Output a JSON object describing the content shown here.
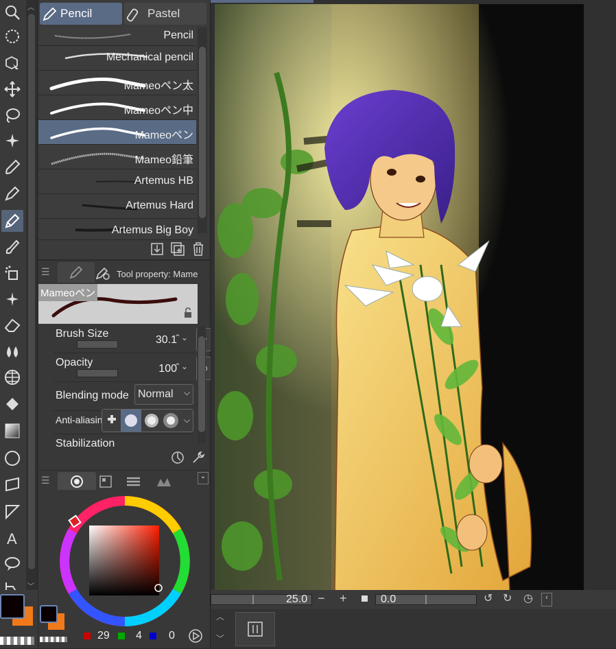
{
  "brush_tabs": {
    "pencil": "Pencil",
    "pastel": "Pastel"
  },
  "brushes": [
    {
      "name": "Pencil",
      "selected": false
    },
    {
      "name": "Mechanical pencil",
      "selected": false
    },
    {
      "name": "Mameoペン太",
      "selected": false
    },
    {
      "name": "Mameoペン中",
      "selected": false
    },
    {
      "name": "Mameoペン",
      "selected": true
    },
    {
      "name": "Mameo鉛筆",
      "selected": false
    },
    {
      "name": "Artemus HB",
      "selected": false
    },
    {
      "name": "Artemus Hard",
      "selected": false
    },
    {
      "name": "Artemus Big Boy",
      "selected": false
    }
  ],
  "tool_property": {
    "header": "Tool property: Mame",
    "preview_label": "Mameoペン",
    "brush_size_label": "Brush Size",
    "brush_size_value": "30.1",
    "opacity_label": "Opacity",
    "opacity_value": "100",
    "blending_label": "Blending mode",
    "blending_value": "Normal",
    "antialias_label": "Anti-aliasin",
    "stabilization_label": "Stabilization"
  },
  "color": {
    "r": "29",
    "g": "4",
    "b": "0",
    "main_color": "#0a0000",
    "sub_color": "#f07a1a",
    "accent": "#5a6b85"
  },
  "canvas_controls": {
    "zoom": "25.0",
    "rotation": "0.0"
  }
}
